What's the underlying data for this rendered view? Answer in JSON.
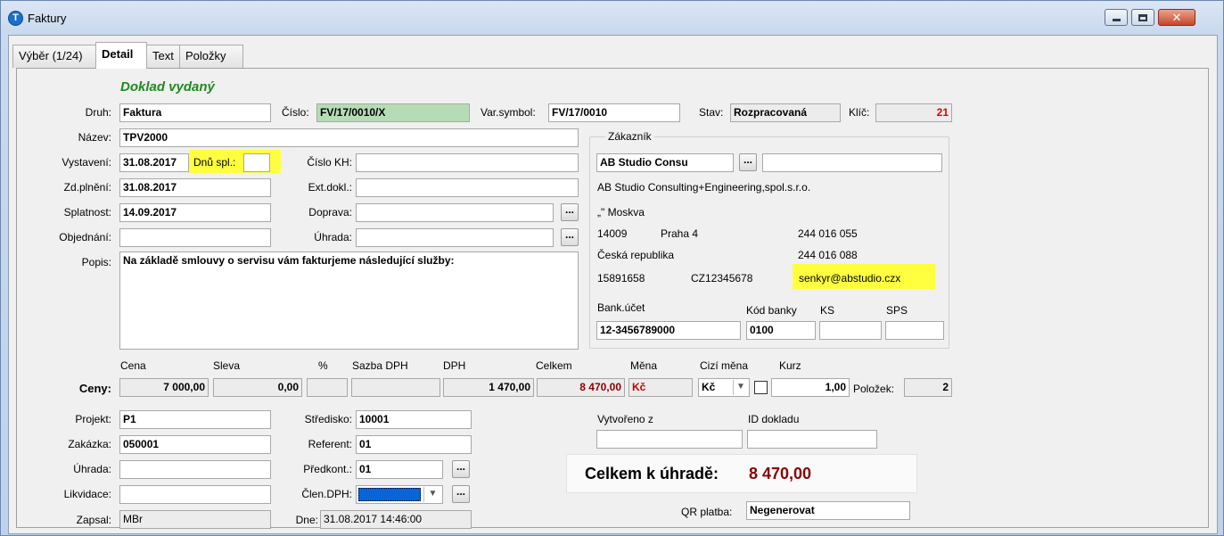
{
  "window": {
    "title": "Faktury"
  },
  "tabs": [
    "Výběr (1/24)",
    "Detail",
    "Text",
    "Položky"
  ],
  "heading": "Doklad vydaný",
  "header": {
    "druh_label": "Druh:",
    "druh": "Faktura",
    "cislo_label": "Číslo:",
    "cislo": "FV/17/0010/X",
    "varsymbol_label": "Var.symbol:",
    "varsymbol": "FV/17/0010",
    "stav_label": "Stav:",
    "stav": "Rozpracovaná",
    "klic_label": "Klíč:",
    "klic": "21"
  },
  "fields": {
    "nazev_label": "Název:",
    "nazev": "TPV2000",
    "vystaveni_label": "Vystavení:",
    "vystaveni": "31.08.2017",
    "dnu_spl_label": "Dnů spl.:",
    "dnu_spl": "",
    "zdplneni_label": "Zd.plnění:",
    "zdplneni": "31.08.2017",
    "splatnost_label": "Splatnost:",
    "splatnost": "14.09.2017",
    "objednani_label": "Objednání:",
    "objednani": "",
    "cislo_kh_label": "Číslo KH:",
    "cislo_kh": "",
    "ext_dokl_label": "Ext.dokl.:",
    "ext_dokl": "",
    "doprava_label": "Doprava:",
    "doprava": "",
    "uhrada_label": "Úhrada:",
    "uhrada": "",
    "popis_label": "Popis:",
    "popis": "Na základě smlouvy o servisu vám fakturjeme následující služby:"
  },
  "customer": {
    "group_title": "Zákazník",
    "short": "AB Studio Consu",
    "extra": "",
    "full_name": "AB Studio Consulting+Engineering,spol.s.r.o.",
    "street": "„\" Moskva",
    "zip": "14009",
    "city": "Praha 4",
    "phone1": "244 016 055",
    "country": "Česká republika",
    "phone2": "244 016 088",
    "ico": "15891658",
    "dic": "CZ12345678",
    "email": "senkyr@abstudio.czx",
    "bank_account_label": "Bank.účet",
    "bank_code_label": "Kód banky",
    "ks_label": "KS",
    "sps_label": "SPS",
    "bank_account": "12-3456789000",
    "bank_code": "0100",
    "ks": "",
    "sps": ""
  },
  "prices": {
    "row_label": "Ceny:",
    "headers": {
      "cena": "Cena",
      "sleva": "Sleva",
      "pct": "%",
      "sazba": "Sazba DPH",
      "dph": "DPH",
      "celkem": "Celkem",
      "mena": "Měna",
      "cizi_mena": "Cizí měna",
      "kurz": "Kurz"
    },
    "cena": "7 000,00",
    "sleva": "0,00",
    "pct": "",
    "sazba": "",
    "dph": "1 470,00",
    "celkem": "8 470,00",
    "mena": "Kč",
    "cizi_mena": "Kč",
    "kurz": "1,00",
    "polozek_label": "Položek:",
    "polozek": "2"
  },
  "bottom": {
    "projekt_label": "Projekt:",
    "projekt": "P1",
    "zakazka_label": "Zakázka:",
    "zakazka": "050001",
    "uhrada_label": "Úhrada:",
    "uhrada": "",
    "likvidace_label": "Likvidace:",
    "likvidace": "",
    "zapsal_label": "Zapsal:",
    "zapsal": "MBr",
    "stredisko_label": "Středisko:",
    "stredisko": "10001",
    "referent_label": "Referent:",
    "referent": "01",
    "predkont_label": "Předkont.:",
    "predkont": "01",
    "clen_dph_label": "Člen.DPH:",
    "clen_dph": "",
    "dne_label": "Dne:",
    "dne": "31.08.2017 14:46:00",
    "vytvoreno_label": "Vytvořeno z",
    "vytvoreno": "",
    "id_dokladu_label": "ID dokladu",
    "id_dokladu": "",
    "total_label": "Celkem k úhradě:",
    "total": "8 470,00",
    "qr_label": "QR platba:",
    "qr": "Negenerovat"
  },
  "colors": {
    "heading": "#1f8a1f",
    "total": "#8b0000",
    "highlight": "#ffff40",
    "cislo_bg": "#b6dcb6"
  }
}
